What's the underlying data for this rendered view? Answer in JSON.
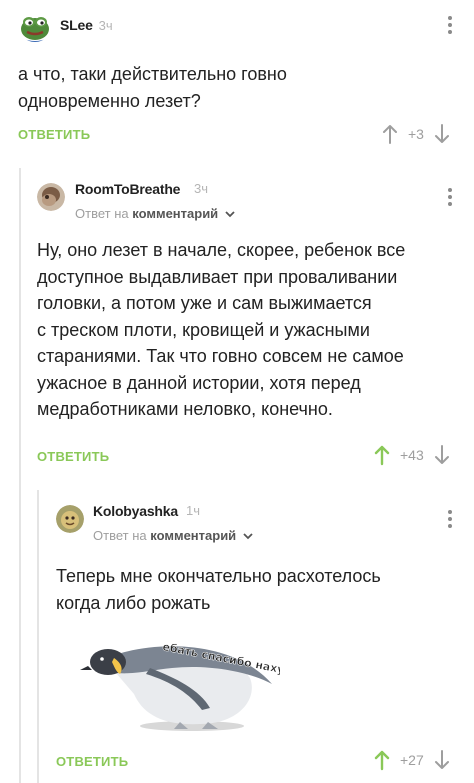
{
  "comments": [
    {
      "username": "SLee",
      "time": "3ч",
      "text_lines": [
        "а что, таки действительно говно",
        "одновременно лезет?"
      ],
      "reply_label": "ОТВЕТИТЬ",
      "rating": "+3"
    },
    {
      "username": "RoomToBreathe",
      "time": "3ч",
      "reply_to_prefix": "Ответ на",
      "reply_to_target": "комментарий",
      "text_lines": [
        "Ну, оно лезет в начале, скорее, ребенок все",
        "доступное выдавливает при проваливании",
        "головки, а потом уже и сам выжимается",
        "с треском плоти, кровищей и ужасными",
        "стараниями. Так что говно совсем не самое",
        "ужасное в данной истории, хотя перед",
        "медработниками неловко, конечно."
      ],
      "reply_label": "ОТВЕТИТЬ",
      "rating": "+43"
    },
    {
      "username": "Kolobyashka",
      "time": "1ч",
      "reply_to_prefix": "Ответ на",
      "reply_to_target": "комментарий",
      "text_lines": [
        "Теперь мне окончательно расхотелось",
        "когда либо рожать"
      ],
      "sticker_caption": "ебать спасибо нахуй",
      "reply_label": "ОТВЕТИТЬ",
      "rating": "+27"
    }
  ],
  "colors": {
    "accent": "#8ac858",
    "muted": "#9e9e9e",
    "thread_line": "#e4e4e4"
  },
  "icons": [
    "pepe-avatar",
    "user-avatar",
    "kebab-menu-icon",
    "arrow-up-icon",
    "arrow-down-icon",
    "chevron-down-icon",
    "penguin-sticker"
  ]
}
